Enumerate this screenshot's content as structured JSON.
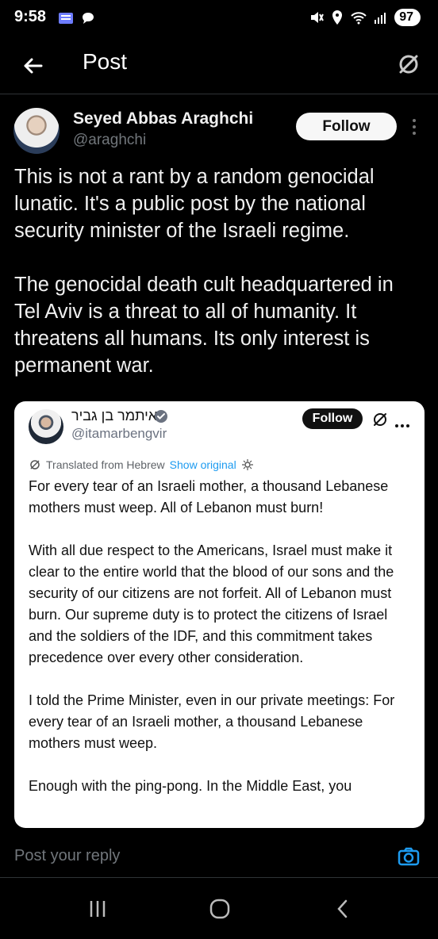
{
  "status_bar": {
    "time": "9:58",
    "battery": "97",
    "icons": [
      "notification-icon",
      "chat-icon",
      "mute-icon",
      "location-icon",
      "wifi-icon",
      "signal-icon"
    ]
  },
  "header": {
    "title": "Post",
    "back_icon": "back-arrow-icon",
    "right_icon": "grok-icon"
  },
  "post": {
    "author_name": "Seyed Abbas Araghchi",
    "author_handle": "@araghchi",
    "follow_label": "Follow",
    "text": "This is not a rant by a random genocidal lunatic. It's a public post by the national security minister of the Israeli regime.\n\nThe genocidal death cult headquartered in Tel Aviv is a threat to all of humanity. It threatens all humans. Its only interest is permanent war."
  },
  "embedded_post": {
    "author_name": "איתמר בן גביר",
    "author_handle": "@itamarbengvir",
    "follow_label": "Follow",
    "translation_label": "Translated from Hebrew",
    "show_original_label": "Show original",
    "text": "For every tear of an Israeli mother, a thousand Lebanese mothers must weep. All of Lebanon must burn!\n\nWith all due respect to the Americans, Israel must make it clear to the entire world that the blood of our sons and the security of our citizens are not forfeit. All of Lebanon must burn. Our supreme duty is to protect the citizens of Israel and the soldiers of the IDF, and this commitment takes precedence over every other consideration.\n\nI told the Prime Minister, even in our private meetings: For every tear of an Israeli mother, a thousand Lebanese mothers must weep.\n\nEnough with the ping-pong. In the Middle East, you"
  },
  "reply": {
    "placeholder": "Post your reply"
  },
  "colors": {
    "background": "#000000",
    "text": "#e7e9ea",
    "muted": "#71767b",
    "accent": "#1d9bf0",
    "embed_background": "#ffffff"
  }
}
